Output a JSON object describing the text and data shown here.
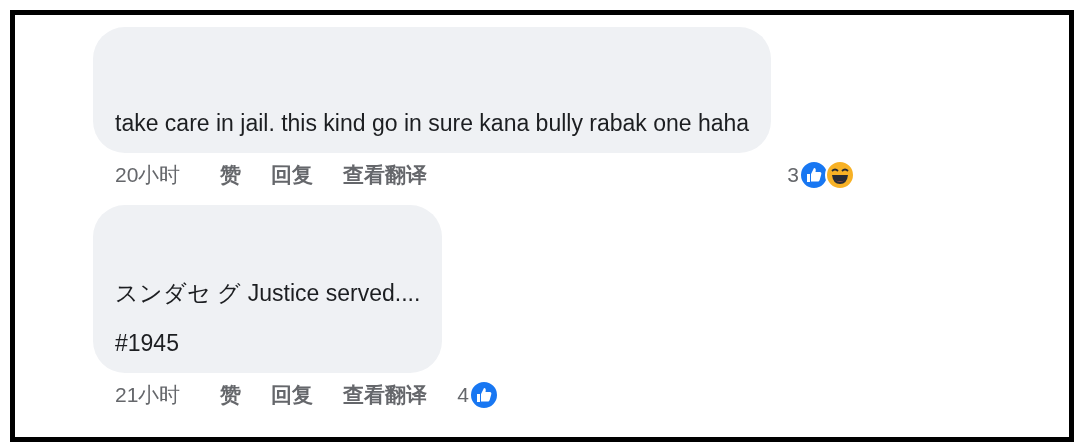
{
  "comments": [
    {
      "lines": [
        "take care in jail. this kind go in sure kana bully rabak one haha"
      ],
      "time": "20小时",
      "actions": [
        "赞",
        "回复",
        "查看翻译"
      ],
      "reaction_count": "3",
      "reactions": [
        {
          "kind": "like"
        },
        {
          "kind": "haha"
        }
      ]
    },
    {
      "lines": [
        "スンダセ グ Justice served....",
        "#1945"
      ],
      "time": "21小时",
      "actions": [
        "赞",
        "回复",
        "查看翻译"
      ],
      "reaction_count": "4",
      "reactions": [
        {
          "kind": "like"
        }
      ]
    }
  ]
}
